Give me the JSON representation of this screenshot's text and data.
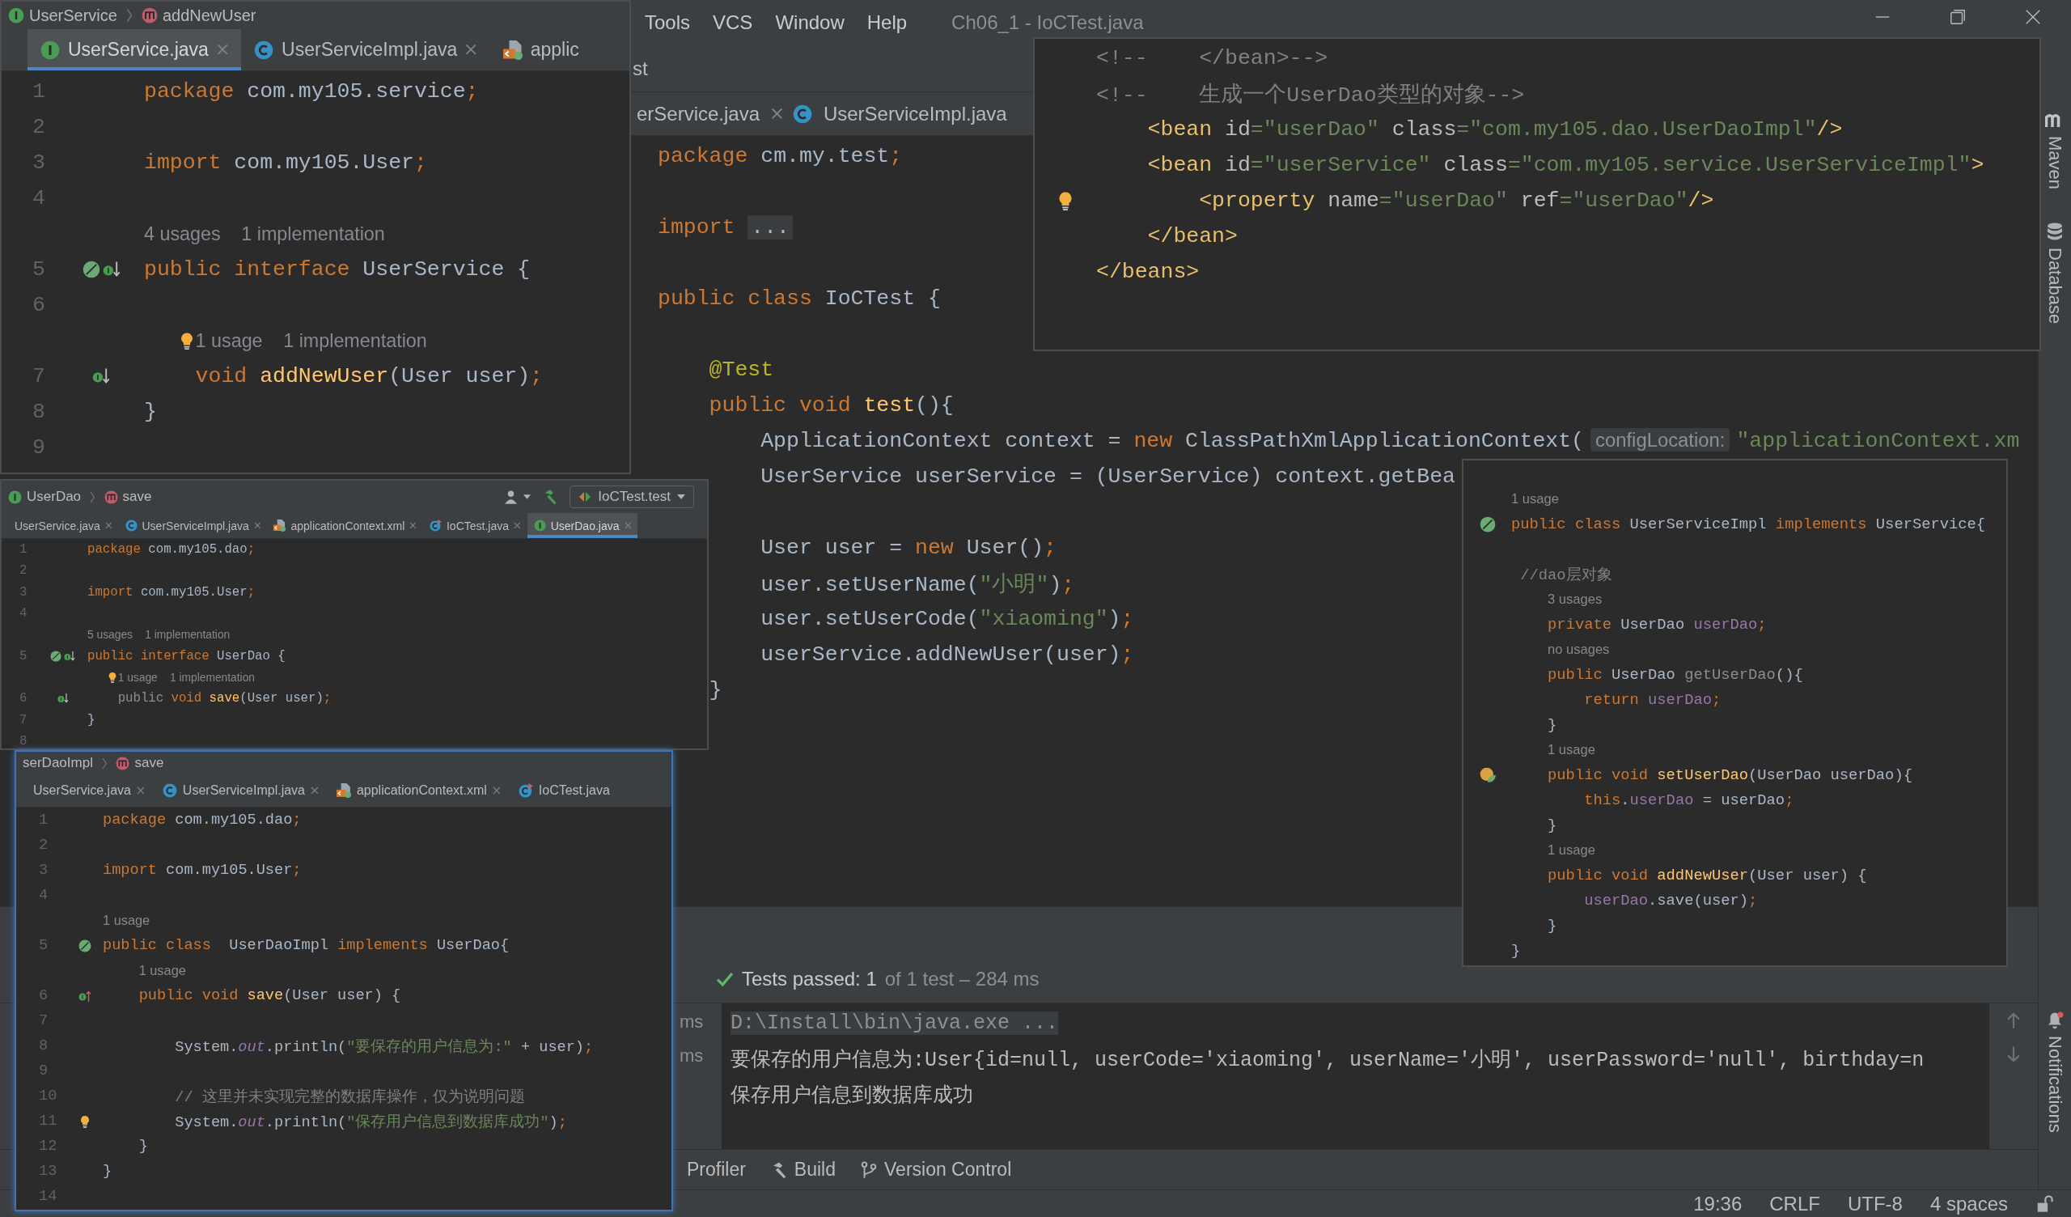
{
  "main_window": {
    "menu": [
      "Tools",
      "VCS",
      "Window",
      "Help"
    ],
    "title": "Ch06_1 - IoCTest.java",
    "navigation": "st",
    "tabs": [
      {
        "label": "erService.java",
        "kind": "plain",
        "selected": false,
        "closable": true
      },
      {
        "label": "UserServiceImpl.java",
        "kind": "class",
        "selected": false,
        "closable": false
      }
    ],
    "editor": {
      "lines": [
        {
          "kind": "code",
          "tokens": [
            {
              "text": "package",
              "kind": "keyword"
            },
            {
              "text": " cm.my.test",
              "kind": "plain"
            },
            {
              "text": ";",
              "kind": "keyword"
            }
          ]
        },
        {
          "kind": "blank"
        },
        {
          "kind": "code",
          "tokens": [
            {
              "text": "import",
              "kind": "keyword"
            },
            {
              "text": "...",
              "kind": "fold"
            }
          ]
        },
        {
          "kind": "blank"
        },
        {
          "kind": "code",
          "tokens": [
            {
              "text": "public class",
              "kind": "keyword"
            },
            {
              "text": " IoCTest {",
              "kind": "plain"
            }
          ]
        },
        {
          "kind": "blank"
        },
        {
          "kind": "code",
          "tokens": [
            {
              "text": "    @Test",
              "kind": "annotation"
            }
          ]
        },
        {
          "kind": "code",
          "tokens": [
            {
              "text": "    public void",
              "kind": "keyword"
            },
            {
              "text": " test",
              "kind": "method"
            },
            {
              "text": "(){",
              "kind": "plain"
            }
          ]
        },
        {
          "kind": "code",
          "tokens": [
            {
              "text": "        ApplicationContext context = ",
              "kind": "plain"
            },
            {
              "text": "new",
              "kind": "keyword"
            },
            {
              "text": " ClassPathXmlApplicationContext(",
              "kind": "plain"
            },
            {
              "text": "configLocation:",
              "kind": "inlay"
            },
            {
              "text": "\"applicationContext.xm",
              "kind": "string"
            }
          ]
        },
        {
          "kind": "code",
          "tokens": [
            {
              "text": "        UserService userService = (UserService) context.getBea",
              "kind": "plain"
            }
          ]
        },
        {
          "kind": "blank"
        },
        {
          "kind": "code",
          "tokens": [
            {
              "text": "        User user = ",
              "kind": "plain"
            },
            {
              "text": "new",
              "kind": "keyword"
            },
            {
              "text": " User()",
              "kind": "plain"
            },
            {
              "text": ";",
              "kind": "keyword"
            }
          ]
        },
        {
          "kind": "code",
          "tokens": [
            {
              "text": "        user.setUserName(",
              "kind": "plain"
            },
            {
              "text": "\"小明\"",
              "kind": "string"
            },
            {
              "text": ")",
              "kind": "plain"
            },
            {
              "text": ";",
              "kind": "keyword"
            }
          ]
        },
        {
          "kind": "code",
          "tokens": [
            {
              "text": "        user.setUserCode(",
              "kind": "plain"
            },
            {
              "text": "\"xiaoming\"",
              "kind": "string"
            },
            {
              "text": ")",
              "kind": "plain"
            },
            {
              "text": ";",
              "kind": "keyword"
            }
          ]
        },
        {
          "kind": "code",
          "tokens": [
            {
              "text": "        userService.addNewUser(user)",
              "kind": "plain"
            },
            {
              "text": ";",
              "kind": "keyword"
            }
          ]
        },
        {
          "kind": "code",
          "tokens": [
            {
              "text": "    }",
              "kind": "plain"
            }
          ]
        }
      ]
    },
    "run_panel": {
      "test_times": [
        "ms",
        "ms"
      ],
      "status": "Tests passed: 1",
      "summary": "of 1 test – 284 ms",
      "console": [
        {
          "text": "D:\\Install\\bin\\java.exe ...",
          "kind": "command"
        },
        {
          "text": "要保存的用户信息为:User{id=null, userCode='xiaoming', userName='小明', userPassword='null', birthday=n",
          "kind": "output"
        },
        {
          "text": "保存用户信息到数据库成功",
          "kind": "output"
        }
      ]
    },
    "tool_tabs": [
      {
        "label": "Profiler",
        "kind": "plain"
      },
      {
        "label": "Build",
        "kind": "build"
      },
      {
        "label": "Version Control",
        "kind": "vcs"
      }
    ],
    "status_bar": [
      "19:36",
      "CRLF",
      "UTF-8",
      "4 spaces"
    ],
    "side_tools": [
      {
        "label": "Maven",
        "kind": "maven"
      },
      {
        "label": "Database",
        "kind": "database"
      }
    ],
    "notifications": "Notifications"
  },
  "windows": [
    {
      "focused": false,
      "breadcrumb": [
        {
          "label": "UserService",
          "kind": "interface"
        },
        {
          "label": "addNewUser",
          "kind": "method"
        }
      ],
      "tabs": [
        {
          "label": "UserService.java",
          "kind": "interface",
          "selected": true,
          "closable": true
        },
        {
          "label": "UserServiceImpl.java",
          "kind": "class",
          "selected": false,
          "closable": true
        },
        {
          "label": "applic",
          "kind": "xml",
          "selected": false,
          "closable": false
        }
      ],
      "lines": [
        {
          "kind": "code",
          "no": "1",
          "tokens": [
            {
              "text": "package",
              "kind": "keyword"
            },
            {
              "text": " com.my105.service",
              "kind": "plain"
            },
            {
              "text": ";",
              "kind": "keyword"
            }
          ]
        },
        {
          "kind": "blank",
          "no": "2"
        },
        {
          "kind": "code",
          "no": "3",
          "tokens": [
            {
              "text": "import",
              "kind": "keyword"
            },
            {
              "text": " com.my105.User",
              "kind": "plain"
            },
            {
              "text": ";",
              "kind": "keyword"
            }
          ]
        },
        {
          "kind": "blank",
          "no": "4"
        },
        {
          "kind": "hint",
          "parts": [
            "4 usages",
            "1 implementation"
          ]
        },
        {
          "kind": "code",
          "no": "5",
          "markers": [
            {
              "kind": "bean"
            },
            {
              "kind": "implemented"
            }
          ],
          "tokens": [
            {
              "text": "public interface",
              "kind": "keyword"
            },
            {
              "text": " UserService {",
              "kind": "plain"
            }
          ]
        },
        {
          "kind": "blank",
          "no": "6"
        },
        {
          "kind": "hint",
          "markers": [
            {
              "kind": "bulb"
            }
          ],
          "parts": [
            "1 usage",
            "1 implementation"
          ]
        },
        {
          "kind": "code",
          "no": "7",
          "markers": [
            {
              "kind": "implemented"
            }
          ],
          "tokens": [
            {
              "text": "    void",
              "kind": "keyword"
            },
            {
              "text": " addNewUser",
              "kind": "method"
            },
            {
              "text": "(User user)",
              "kind": "plain"
            },
            {
              "text": ";",
              "kind": "keyword"
            }
          ]
        },
        {
          "kind": "code",
          "no": "8",
          "tokens": [
            {
              "text": "}",
              "kind": "plain"
            }
          ]
        },
        {
          "kind": "blank",
          "no": "9"
        }
      ]
    },
    {
      "focused": false,
      "breadcrumb": [
        {
          "label": "UserDao",
          "kind": "interface"
        },
        {
          "label": "save",
          "kind": "method"
        }
      ],
      "toolbar": {
        "run_config": "IoCTest.test"
      },
      "tabs": [
        {
          "label": "UserService.java",
          "kind": "plain",
          "selected": false,
          "closable": true
        },
        {
          "label": "UserServiceImpl.java",
          "kind": "class",
          "selected": false,
          "closable": true
        },
        {
          "label": "applicationContext.xml",
          "kind": "xml",
          "selected": false,
          "closable": true
        },
        {
          "label": "IoCTest.java",
          "kind": "test",
          "selected": false,
          "closable": true
        },
        {
          "label": "UserDao.java",
          "kind": "interface",
          "selected": true,
          "closable": true
        }
      ],
      "lines": [
        {
          "kind": "code",
          "no": "1",
          "tokens": [
            {
              "text": "package",
              "kind": "keyword"
            },
            {
              "text": " com.my105.dao",
              "kind": "plain"
            },
            {
              "text": ";",
              "kind": "keyword"
            }
          ]
        },
        {
          "kind": "blank",
          "no": "2"
        },
        {
          "kind": "code",
          "no": "3",
          "tokens": [
            {
              "text": "import",
              "kind": "keyword"
            },
            {
              "text": " com.my105.User",
              "kind": "plain"
            },
            {
              "text": ";",
              "kind": "keyword"
            }
          ]
        },
        {
          "kind": "blank",
          "no": "4"
        },
        {
          "kind": "hint",
          "parts": [
            "5 usages",
            "1 implementation"
          ]
        },
        {
          "kind": "code",
          "no": "5",
          "markers": [
            {
              "kind": "bean"
            },
            {
              "kind": "implemented"
            }
          ],
          "tokens": [
            {
              "text": "public interface",
              "kind": "keyword"
            },
            {
              "text": " UserDao {",
              "kind": "plain"
            }
          ]
        },
        {
          "kind": "hint",
          "markers": [
            {
              "kind": "bulb"
            }
          ],
          "parts": [
            "1 usage",
            "1 implementation"
          ]
        },
        {
          "kind": "code",
          "no": "6",
          "markers": [
            {
              "kind": "implemented"
            }
          ],
          "tokens": [
            {
              "text": "    public",
              "kind": "dim"
            },
            {
              "text": " void",
              "kind": "keyword"
            },
            {
              "text": " save",
              "kind": "method"
            },
            {
              "text": "(User user)",
              "kind": "plain"
            },
            {
              "text": ";",
              "kind": "keyword"
            }
          ]
        },
        {
          "kind": "code",
          "no": "7",
          "tokens": [
            {
              "text": "}",
              "kind": "plain"
            }
          ]
        },
        {
          "kind": "blank",
          "no": "8"
        }
      ]
    },
    {
      "focused": true,
      "breadcrumb": [
        {
          "label": "serDaoImpl",
          "kind": "plain"
        },
        {
          "label": "save",
          "kind": "method"
        }
      ],
      "tabs": [
        {
          "label": "UserService.java",
          "kind": "plain",
          "selected": false,
          "closable": true
        },
        {
          "label": "UserServiceImpl.java",
          "kind": "class",
          "selected": false,
          "closable": true
        },
        {
          "label": "applicationContext.xml",
          "kind": "xml",
          "selected": false,
          "closable": true
        },
        {
          "label": "IoCTest.java",
          "kind": "test",
          "selected": false,
          "closable": false
        }
      ],
      "lines": [
        {
          "kind": "code",
          "no": "1",
          "tokens": [
            {
              "text": "package",
              "kind": "keyword"
            },
            {
              "text": " com.my105.dao",
              "kind": "plain"
            },
            {
              "text": ";",
              "kind": "keyword"
            }
          ]
        },
        {
          "kind": "blank",
          "no": "2"
        },
        {
          "kind": "code",
          "no": "3",
          "tokens": [
            {
              "text": "import",
              "kind": "keyword"
            },
            {
              "text": " com.my105.User",
              "kind": "plain"
            },
            {
              "text": ";",
              "kind": "keyword"
            }
          ]
        },
        {
          "kind": "blank",
          "no": "4"
        },
        {
          "kind": "hint",
          "parts": [
            "1 usage"
          ]
        },
        {
          "kind": "code",
          "no": "5",
          "markers": [
            {
              "kind": "bean"
            }
          ],
          "tokens": [
            {
              "text": "public class",
              "kind": "keyword"
            },
            {
              "text": "  UserDaoImpl ",
              "kind": "plain"
            },
            {
              "text": "implements",
              "kind": "keyword"
            },
            {
              "text": " UserDao{",
              "kind": "plain"
            }
          ]
        },
        {
          "kind": "hint",
          "parts": [
            "1 usage"
          ]
        },
        {
          "kind": "code",
          "no": "6",
          "markers": [
            {
              "kind": "overriding"
            }
          ],
          "tokens": [
            {
              "text": "    public void",
              "kind": "keyword"
            },
            {
              "text": " save",
              "kind": "method"
            },
            {
              "text": "(User user) {",
              "kind": "plain"
            }
          ]
        },
        {
          "kind": "blank",
          "no": "7"
        },
        {
          "kind": "code",
          "no": "8",
          "tokens": [
            {
              "text": "        System.",
              "kind": "plain"
            },
            {
              "text": "out",
              "kind": "static"
            },
            {
              "text": ".println(",
              "kind": "plain"
            },
            {
              "text": "\"要保存的用户信息为:\"",
              "kind": "string"
            },
            {
              "text": " + user)",
              "kind": "plain"
            },
            {
              "text": ";",
              "kind": "keyword"
            }
          ]
        },
        {
          "kind": "blank",
          "no": "9"
        },
        {
          "kind": "code",
          "no": "10",
          "tokens": [
            {
              "text": "        // 这里并未实现完整的数据库操作，仅为说明问题",
              "kind": "comment"
            }
          ]
        },
        {
          "kind": "code",
          "no": "11",
          "markers": [
            {
              "kind": "bulb"
            }
          ],
          "tokens": [
            {
              "text": "        System.",
              "kind": "plain"
            },
            {
              "text": "out",
              "kind": "static"
            },
            {
              "text": ".println(",
              "kind": "plain"
            },
            {
              "text": "\"保存用户信息到数据库成功\"",
              "kind": "string"
            },
            {
              "text": ")",
              "kind": "plain"
            },
            {
              "text": ";",
              "kind": "keyword"
            }
          ]
        },
        {
          "kind": "code",
          "no": "12",
          "tokens": [
            {
              "text": "    }",
              "kind": "plain"
            }
          ]
        },
        {
          "kind": "code",
          "no": "13",
          "tokens": [
            {
              "text": "}",
              "kind": "plain"
            }
          ]
        },
        {
          "kind": "blank",
          "no": "14"
        }
      ]
    },
    {
      "focused": false,
      "lines": [
        {
          "kind": "code",
          "tokens": [
            {
              "text": "<!--    </bean>-->",
              "kind": "comment"
            }
          ]
        },
        {
          "kind": "code",
          "tokens": [
            {
              "text": "<!--    生成一个UserDao类型的对象-->",
              "kind": "comment"
            }
          ]
        },
        {
          "kind": "code",
          "tokens": [
            {
              "text": "    <bean",
              "kind": "tag"
            },
            {
              "text": " id",
              "kind": "attr"
            },
            {
              "text": "=\"userDao\"",
              "kind": "string"
            },
            {
              "text": " class",
              "kind": "attr"
            },
            {
              "text": "=\"com.my105.dao.UserDaoImpl\"",
              "kind": "string"
            },
            {
              "text": "/>",
              "kind": "tag"
            }
          ]
        },
        {
          "kind": "code",
          "tokens": [
            {
              "text": "    <bean",
              "kind": "tag"
            },
            {
              "text": " id",
              "kind": "attr"
            },
            {
              "text": "=\"userService\"",
              "kind": "string"
            },
            {
              "text": " class",
              "kind": "attr"
            },
            {
              "text": "=\"com.my105.service.UserServiceImpl\"",
              "kind": "string"
            },
            {
              "text": ">",
              "kind": "tag"
            }
          ]
        },
        {
          "kind": "code",
          "markers": [
            {
              "kind": "bulb"
            }
          ],
          "tokens": [
            {
              "text": "        <property",
              "kind": "tag"
            },
            {
              "text": " name",
              "kind": "attr"
            },
            {
              "text": "=\"userDao\"",
              "kind": "string"
            },
            {
              "text": " ref",
              "kind": "attr"
            },
            {
              "text": "=\"userDao\"",
              "kind": "string"
            },
            {
              "text": "/>",
              "kind": "tag"
            }
          ]
        },
        {
          "kind": "code",
          "tokens": [
            {
              "text": "    </bean>",
              "kind": "tag"
            }
          ]
        },
        {
          "kind": "code",
          "tokens": [
            {
              "text": "</beans>",
              "kind": "tag"
            }
          ]
        }
      ]
    },
    {
      "focused": false,
      "lines": [
        {
          "kind": "hint",
          "parts": [
            "1 usage"
          ]
        },
        {
          "kind": "code",
          "markers": [
            {
              "kind": "bean"
            }
          ],
          "tokens": [
            {
              "text": "public class",
              "kind": "keyword"
            },
            {
              "text": " UserServiceImpl ",
              "kind": "plain"
            },
            {
              "text": "implements",
              "kind": "keyword"
            },
            {
              "text": " UserService{",
              "kind": "plain"
            }
          ]
        },
        {
          "kind": "blank"
        },
        {
          "kind": "code",
          "tokens": [
            {
              "text": " //dao层对象",
              "kind": "comment"
            }
          ]
        },
        {
          "kind": "hint",
          "parts": [
            "3 usages"
          ]
        },
        {
          "kind": "code",
          "tokens": [
            {
              "text": "    private",
              "kind": "keyword"
            },
            {
              "text": " UserDao ",
              "kind": "plain"
            },
            {
              "text": "userDao",
              "kind": "field"
            },
            {
              "text": ";",
              "kind": "keyword"
            }
          ]
        },
        {
          "kind": "hint",
          "parts": [
            "no usages"
          ]
        },
        {
          "kind": "code",
          "tokens": [
            {
              "text": "    public",
              "kind": "keyword"
            },
            {
              "text": " UserDao ",
              "kind": "plain"
            },
            {
              "text": "getUserDao",
              "kind": "dim"
            },
            {
              "text": "(){",
              "kind": "plain"
            }
          ]
        },
        {
          "kind": "code",
          "tokens": [
            {
              "text": "        return",
              "kind": "keyword"
            },
            {
              "text": " userDao",
              "kind": "field"
            },
            {
              "text": ";",
              "kind": "keyword"
            }
          ]
        },
        {
          "kind": "code",
          "tokens": [
            {
              "text": "    }",
              "kind": "plain"
            }
          ]
        },
        {
          "kind": "hint",
          "parts": [
            "1 usage"
          ]
        },
        {
          "kind": "code",
          "markers": [
            {
              "kind": "property"
            }
          ],
          "tokens": [
            {
              "text": "    public void",
              "kind": "keyword"
            },
            {
              "text": " setUserDao",
              "kind": "method"
            },
            {
              "text": "(UserDao userDao){",
              "kind": "plain"
            }
          ]
        },
        {
          "kind": "code",
          "tokens": [
            {
              "text": "        this",
              "kind": "keyword"
            },
            {
              "text": ".",
              "kind": "plain"
            },
            {
              "text": "userDao",
              "kind": "field"
            },
            {
              "text": " = userDao",
              "kind": "plain"
            },
            {
              "text": ";",
              "kind": "keyword"
            }
          ]
        },
        {
          "kind": "code",
          "tokens": [
            {
              "text": "    }",
              "kind": "plain"
            }
          ]
        },
        {
          "kind": "hint",
          "parts": [
            "1 usage"
          ]
        },
        {
          "kind": "code",
          "tokens": [
            {
              "text": "    public void",
              "kind": "keyword"
            },
            {
              "text": " addNewUser",
              "kind": "method"
            },
            {
              "text": "(User user) {",
              "kind": "plain"
            }
          ]
        },
        {
          "kind": "code",
          "tokens": [
            {
              "text": "        userDao",
              "kind": "field"
            },
            {
              "text": ".save(user)",
              "kind": "plain"
            },
            {
              "text": ";",
              "kind": "keyword"
            }
          ]
        },
        {
          "kind": "code",
          "tokens": [
            {
              "text": "    }",
              "kind": "plain"
            }
          ]
        },
        {
          "kind": "code",
          "tokens": [
            {
              "text": "}",
              "kind": "plain"
            }
          ]
        }
      ]
    }
  ]
}
